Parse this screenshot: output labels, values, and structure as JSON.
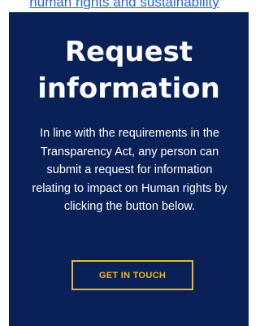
{
  "top_link": {
    "text": "human rights and sustainability"
  },
  "card": {
    "title_line1": "Request",
    "title_line2": "information",
    "body": "In line with the requirements in the Transparency Act, any person can submit a request for information relating to impact on Human rights by clicking the button below.",
    "button_label": "GET IN TOUCH"
  },
  "colors": {
    "card_background": "#0a2158",
    "accent": "#e8b923",
    "link": "#2a64c8",
    "text": "#ffffff"
  }
}
